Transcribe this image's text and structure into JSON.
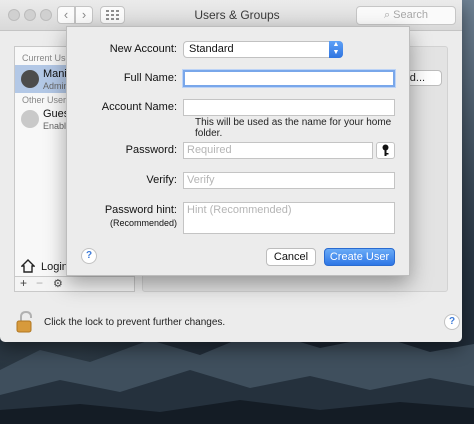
{
  "window": {
    "title": "Users & Groups",
    "search_placeholder": "Search"
  },
  "userlist": {
    "current_users_header": "Current Use",
    "current_user_name": "Manis",
    "current_user_role": "Admin",
    "other_users_header": "Other Users",
    "guest_name": "Gues",
    "guest_status": "Enabl",
    "login_options": "Login"
  },
  "background": {
    "partial_button_label": "ord..."
  },
  "footer": {
    "lock_text": "Click the lock to prevent further changes."
  },
  "sheet": {
    "new_account_label": "New Account:",
    "new_account_value": "Standard",
    "full_name_label": "Full Name:",
    "full_name_value": "",
    "account_name_label": "Account Name:",
    "account_name_value": "",
    "account_name_hint": "This will be used as the name for your home folder.",
    "password_label": "Password:",
    "password_placeholder": "Required",
    "verify_label": "Verify:",
    "verify_placeholder": "Verify",
    "hint_label": "Password hint:",
    "hint_sublabel": "(Recommended)",
    "hint_placeholder": "Hint (Recommended)",
    "cancel_label": "Cancel",
    "create_label": "Create User",
    "help_label": "?"
  },
  "colors": {
    "accent": "#2d76e6",
    "selection": "#b3c8e6"
  }
}
